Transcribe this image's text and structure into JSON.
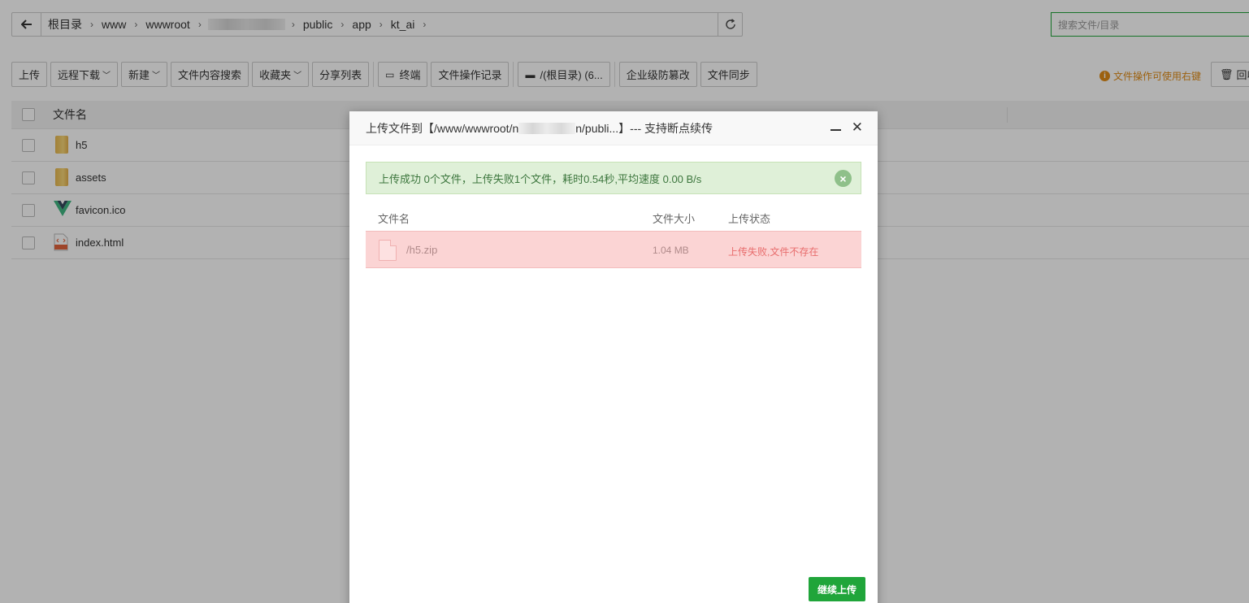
{
  "pathbar": {
    "crumbs": [
      "根目录",
      "www",
      "wwwroot",
      "public",
      "app",
      "kt_ai"
    ]
  },
  "search": {
    "placeholder": "搜索文件/目录"
  },
  "toolbar": {
    "upload": "上传",
    "remote_download": "远程下载",
    "new": "新建",
    "content_search": "文件内容搜索",
    "favorites": "收藏夹",
    "share_list": "分享列表",
    "terminal": "终端",
    "op_log": "文件操作记录",
    "disk": "/(根目录) (6...",
    "tamper": "企业级防篡改",
    "sync": "文件同步",
    "recycle": "回收"
  },
  "hint": "文件操作可使用右键",
  "table": {
    "header_name": "文件名",
    "files": [
      {
        "name": "h5",
        "type": "folder"
      },
      {
        "name": "assets",
        "type": "folder"
      },
      {
        "name": "favicon.ico",
        "type": "vue-icon"
      },
      {
        "name": "index.html",
        "type": "html-icon"
      }
    ]
  },
  "dialog": {
    "title_prefix": "上传文件到【/www/wwwroot/n",
    "title_suffix": "n/publi...】--- 支持断点续传",
    "alert": "上传成功 0个文件，上传失败1个文件，耗时0.54秒,平均速度 0.00 B/s",
    "columns": {
      "name": "文件名",
      "size": "文件大小",
      "status": "上传状态"
    },
    "rows": [
      {
        "name": "/h5.zip",
        "size": "1.04 MB",
        "status": "上传失败,文件不存在"
      }
    ],
    "continue_label": "继续上传"
  },
  "colors": {
    "accent": "#20a53a",
    "error_bg": "#fbd4d4",
    "success_bg": "#dff0d8",
    "warning": "#e08b16"
  }
}
